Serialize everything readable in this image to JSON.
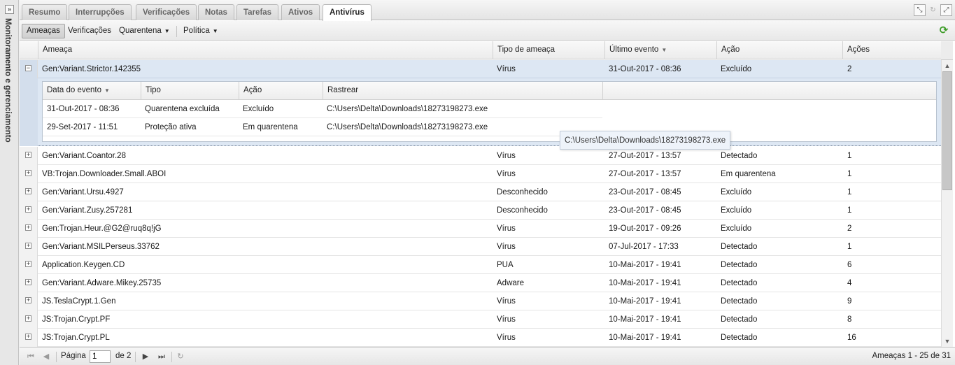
{
  "side_panel": {
    "title": "Monitoramento e gerenciamento",
    "expand_glyph": "»"
  },
  "tabs": [
    "Resumo",
    "Interrupções",
    "Verificações",
    "Notas",
    "Tarefas",
    "Ativos",
    "Antivírus"
  ],
  "active_tab": "Antivírus",
  "window_tools": {
    "collapse": "⤡",
    "reload": "↻",
    "expand": "⤢"
  },
  "subtabs": {
    "threats": "Ameaças",
    "scans": "Verificações",
    "quarantine": "Quarentena",
    "policy": "Política"
  },
  "refresh_glyph": "⟳",
  "columns": {
    "threat": "Ameaça",
    "type": "Tipo de ameaça",
    "last_event": "Último evento",
    "action": "Ação",
    "actions": "Ações"
  },
  "selected_row": {
    "threat": "Gen:Variant.Strictor.142355",
    "type": "Vírus",
    "last_event": "31-Out-2017 - 08:36",
    "action": "Excluído",
    "actions": "2",
    "expander": "−"
  },
  "detail": {
    "columns": {
      "date": "Data do evento",
      "type": "Tipo",
      "action": "Ação",
      "trace": "Rastrear"
    },
    "rows": [
      {
        "date": "31-Out-2017 - 08:36",
        "type": "Quarentena excluída",
        "action": "Excluído",
        "trace": "C:\\Users\\Delta\\Downloads\\18273198273.exe"
      },
      {
        "date": "29-Set-2017 - 11:51",
        "type": "Proteção ativa",
        "action": "Em quarentena",
        "trace": "C:\\Users\\Delta\\Downloads\\18273198273.exe"
      }
    ]
  },
  "tooltip": "C:\\Users\\Delta\\Downloads\\18273198273.exe",
  "rows": [
    {
      "threat": "Gen:Variant.Coantor.28",
      "type": "Vírus",
      "last_event": "27-Out-2017 - 13:57",
      "action": "Detectado",
      "actions": "1"
    },
    {
      "threat": "VB:Trojan.Downloader.Small.ABOI",
      "type": "Vírus",
      "last_event": "27-Out-2017 - 13:57",
      "action": "Em quarentena",
      "actions": "1"
    },
    {
      "threat": "Gen:Variant.Ursu.4927",
      "type": "Desconhecido",
      "last_event": "23-Out-2017 - 08:45",
      "action": "Excluído",
      "actions": "1"
    },
    {
      "threat": "Gen:Variant.Zusy.257281",
      "type": "Desconhecido",
      "last_event": "23-Out-2017 - 08:45",
      "action": "Excluído",
      "actions": "1"
    },
    {
      "threat": "Gen:Trojan.Heur.@G2@ruq8q!jG",
      "type": "Vírus",
      "last_event": "19-Out-2017 - 09:26",
      "action": "Excluído",
      "actions": "2"
    },
    {
      "threat": "Gen:Variant.MSILPerseus.33762",
      "type": "Vírus",
      "last_event": "07-Jul-2017 - 17:33",
      "action": "Detectado",
      "actions": "1"
    },
    {
      "threat": "Application.Keygen.CD",
      "type": "PUA",
      "last_event": "10-Mai-2017 - 19:41",
      "action": "Detectado",
      "actions": "6"
    },
    {
      "threat": "Gen:Variant.Adware.Mikey.25735",
      "type": "Adware",
      "last_event": "10-Mai-2017 - 19:41",
      "action": "Detectado",
      "actions": "4"
    },
    {
      "threat": "JS.TeslaCrypt.1.Gen",
      "type": "Vírus",
      "last_event": "10-Mai-2017 - 19:41",
      "action": "Detectado",
      "actions": "9"
    },
    {
      "threat": "JS:Trojan.Crypt.PF",
      "type": "Vírus",
      "last_event": "10-Mai-2017 - 19:41",
      "action": "Detectado",
      "actions": "8"
    },
    {
      "threat": "JS:Trojan.Crypt.PL",
      "type": "Vírus",
      "last_event": "10-Mai-2017 - 19:41",
      "action": "Detectado",
      "actions": "16"
    }
  ],
  "expander_plus": "+",
  "pager": {
    "page_label": "Página",
    "page_value": "1",
    "of_label": "de 2",
    "summary": "Ameaças 1 - 25 de 31"
  }
}
